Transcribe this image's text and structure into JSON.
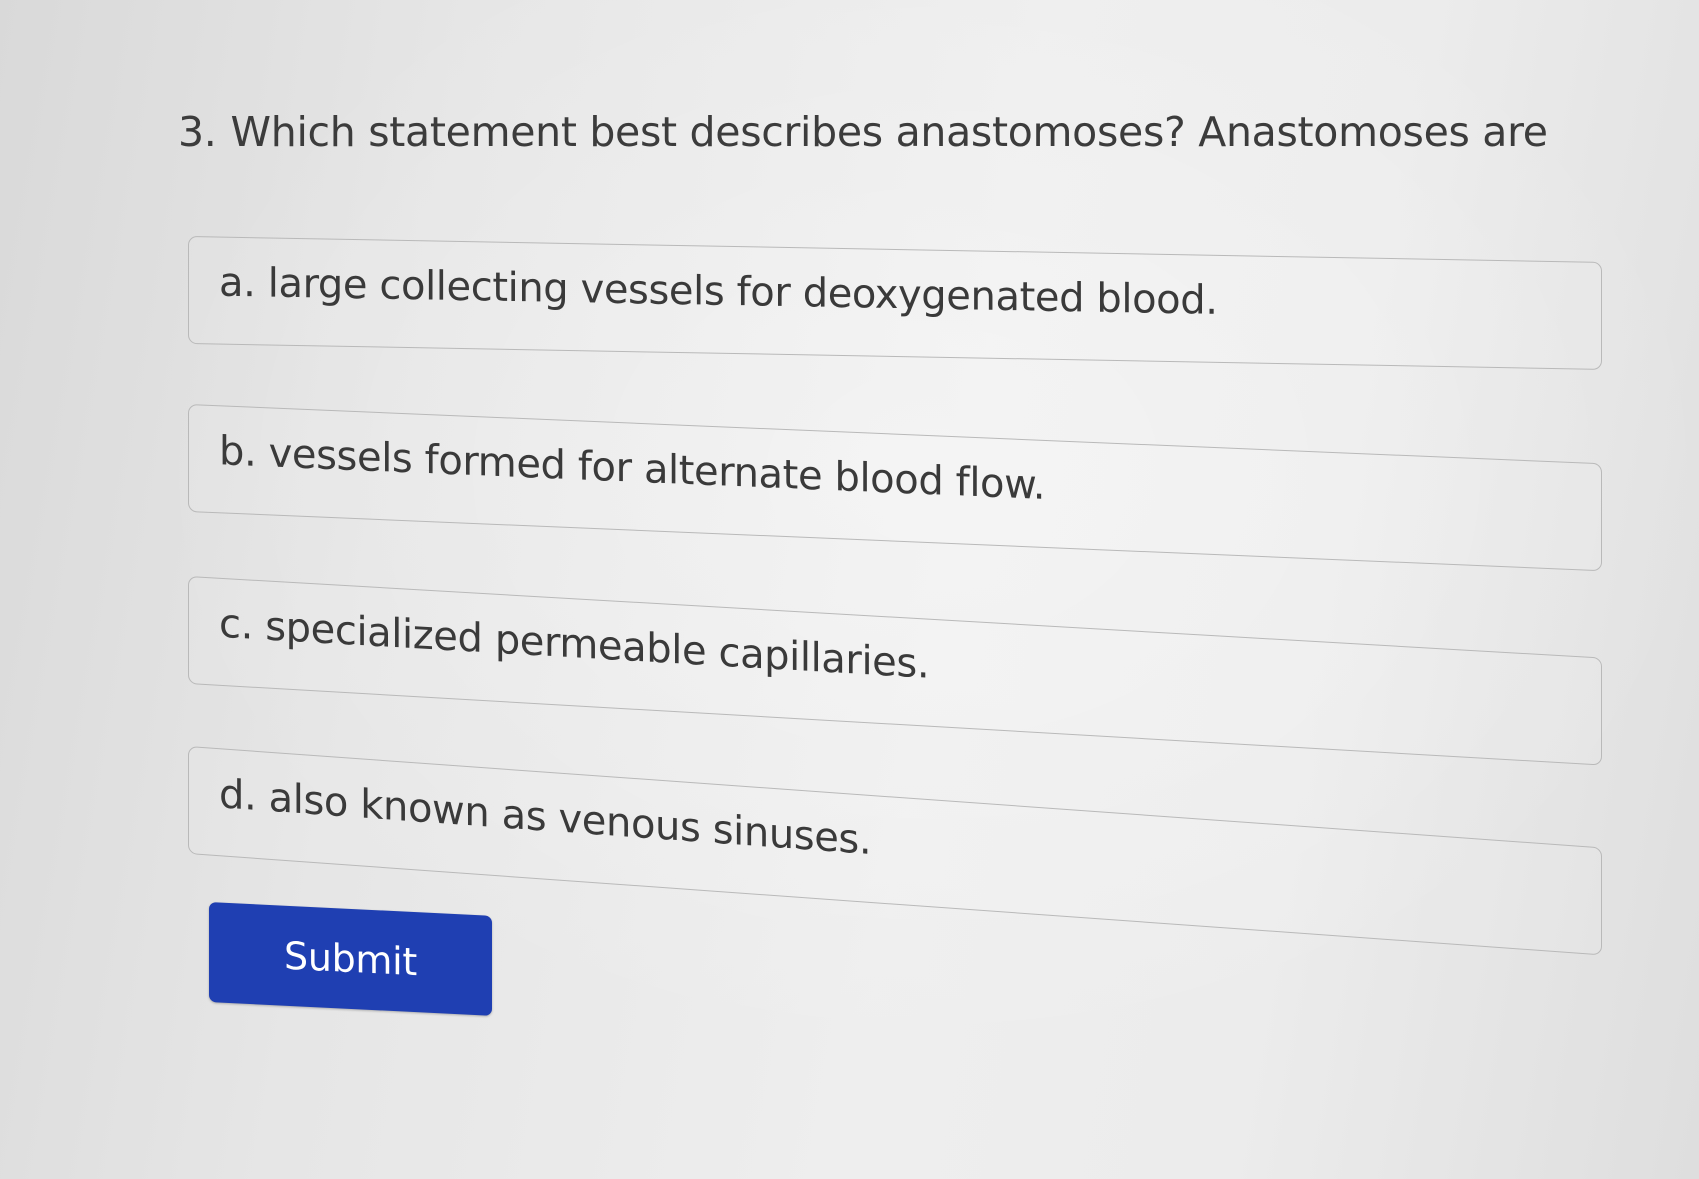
{
  "question": {
    "number": "3.",
    "text": "Which statement best describes anastomoses? Anastomoses are"
  },
  "options": [
    {
      "label": "a. large collecting vessels for deoxygenated blood."
    },
    {
      "label": "b. vessels formed for alternate blood flow."
    },
    {
      "label": "c. specialized permeable capillaries."
    },
    {
      "label": "d. also known as venous sinuses."
    }
  ],
  "submit": {
    "label": "Submit"
  },
  "colors": {
    "accent": "#1f3fb2",
    "background": "#e8e8e8",
    "text": "#3a3a3a",
    "border": "#b9b9b9"
  }
}
